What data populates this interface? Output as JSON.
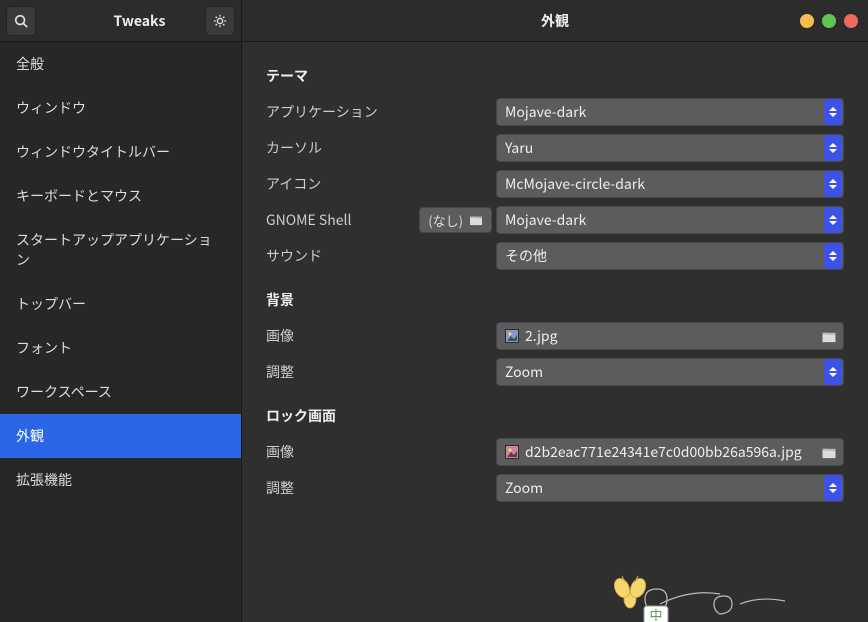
{
  "header": {
    "app_name": "Tweaks",
    "page_title": "外観"
  },
  "sidebar": {
    "items": [
      {
        "label": "全般"
      },
      {
        "label": "ウィンドウ"
      },
      {
        "label": "ウィンドウタイトルバー"
      },
      {
        "label": "キーボードとマウス"
      },
      {
        "label": "スタートアップアプリケーション"
      },
      {
        "label": "トップバー"
      },
      {
        "label": "フォント"
      },
      {
        "label": "ワークスペース"
      },
      {
        "label": "外観"
      },
      {
        "label": "拡張機能"
      }
    ],
    "active_index": 8
  },
  "sections": {
    "theme": {
      "title": "テーマ",
      "rows": {
        "applications": {
          "label": "アプリケーション",
          "value": "Mojave-dark"
        },
        "cursor": {
          "label": "カーソル",
          "value": "Yaru"
        },
        "icons": {
          "label": "アイコン",
          "value": "McMojave-circle-dark"
        },
        "gnome_shell": {
          "label": "GNOME Shell",
          "button_text": "(なし)",
          "value": "Mojave-dark"
        },
        "sound": {
          "label": "サウンド",
          "value": "その他"
        }
      }
    },
    "background": {
      "title": "背景",
      "rows": {
        "image": {
          "label": "画像",
          "value": "2.jpg"
        },
        "adjustment": {
          "label": "調整",
          "value": "Zoom"
        }
      }
    },
    "lockscreen": {
      "title": "ロック画面",
      "rows": {
        "image": {
          "label": "画像",
          "value": "d2b2eac771e24341e7c0d00bb26a596a.jpg"
        },
        "adjustment": {
          "label": "調整",
          "value": "Zoom"
        }
      }
    }
  },
  "ime": {
    "indicator": "中"
  }
}
